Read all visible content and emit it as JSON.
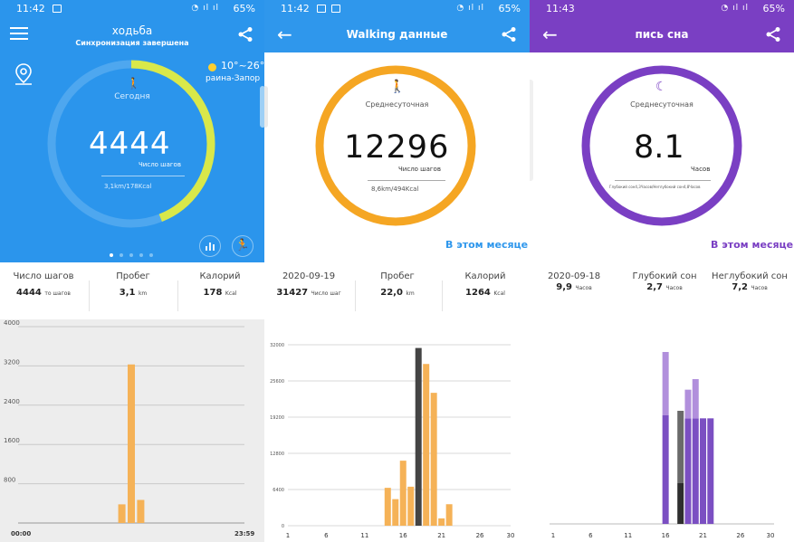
{
  "status_bar": [
    {
      "time": "11:42",
      "battery": "65%"
    },
    {
      "time": "11:42",
      "battery": "65%"
    },
    {
      "time": "11:43",
      "battery": "65%"
    }
  ],
  "panel1": {
    "title": "ходьба",
    "subtitle": "Синхронизация завершена",
    "today_label": "Сегодня",
    "steps": "4444",
    "steps_label": "Число шагов",
    "distance_kcal": "3,1km/178Kcal",
    "weather": "10°~26°",
    "location": "раина-Запор",
    "colors": {
      "header": "#2b95ec",
      "ring_track": "#4ea7ef",
      "ring_progress": "#d9e84a"
    },
    "progress_fraction": 0.44,
    "stats": [
      {
        "label": "Число шагов",
        "value": "4444",
        "unit": "то шагов"
      },
      {
        "label": "Пробег",
        "value": "3,1",
        "unit": "km"
      },
      {
        "label": "Калорий",
        "value": "178",
        "unit": "Kcal"
      }
    ]
  },
  "panel2": {
    "title": "Walking данные",
    "ring_label": "Среднесуточная",
    "value": "12296",
    "value_label": "Число шагов",
    "distance_kcal": "8,6km/494Kcal",
    "month_link": "В этом месяце",
    "colors": {
      "ring": "#f5a623",
      "accent": "#2f97ec"
    },
    "stats": [
      {
        "label": "2020-09-19",
        "value": "31427",
        "unit": "Число шаг"
      },
      {
        "label": "Пробег",
        "value": "22,0",
        "unit": "km"
      },
      {
        "label": "Калорий",
        "value": "1264",
        "unit": "Kcal"
      }
    ]
  },
  "panel3": {
    "title": "пись сна",
    "ring_label": "Среднесуточная",
    "value": "8.1",
    "value_label": "Часов",
    "sub_text": "Глубокий сон4,3Часов/Неглубокий сон4,8Часов",
    "month_link": "В этом месяце",
    "colors": {
      "ring": "#7a3fc3",
      "deep": "#7b4fc2",
      "light": "#b18fdc",
      "selected": "#444444"
    },
    "stats": [
      {
        "label": "2020-09-18",
        "value": "9,9",
        "unit": "Часов"
      },
      {
        "label": "Глубокий сон",
        "value": "2,7",
        "unit": "Часов"
      },
      {
        "label": "Неглубокий сон",
        "value": "7,2",
        "unit": "Часов"
      }
    ]
  },
  "chart_data": [
    {
      "type": "bar",
      "x": [
        11,
        12,
        13
      ],
      "x_tick_labels": [
        "00:00",
        "23:59"
      ],
      "values": [
        380,
        3230,
        470
      ],
      "ylim": [
        0,
        4000
      ],
      "y_ticks": [
        800,
        1600,
        2400,
        3200,
        4000
      ],
      "grid": true,
      "color": "#f5b257"
    },
    {
      "type": "bar",
      "x": [
        14,
        15,
        16,
        17,
        18,
        19,
        20,
        21,
        22,
        23
      ],
      "values": [
        6700,
        4700,
        11500,
        6900,
        31427,
        28600,
        23500,
        1300,
        3800,
        0
      ],
      "highlight_index": 4,
      "ylim": [
        0,
        32000
      ],
      "y_ticks": [
        0,
        6400,
        12800,
        19200,
        25600,
        32000
      ],
      "x_tick_labels": [
        "1",
        "6",
        "11",
        "16",
        "21",
        "26",
        "30"
      ],
      "grid": true,
      "colors": {
        "bar": "#f5b257",
        "highlight": "#444444"
      }
    },
    {
      "type": "bar",
      "x": [
        16,
        18,
        19,
        20,
        21,
        22
      ],
      "series": [
        {
          "name": "Глубокий сон",
          "values": [
            7.2,
            2.7,
            7.0,
            7.0,
            7.0,
            7.0
          ]
        },
        {
          "name": "Неглубокий сон",
          "values": [
            4.2,
            4.8,
            1.9,
            2.6,
            0,
            0
          ]
        }
      ],
      "highlight_index": 1,
      "x_tick_labels": [
        "1",
        "6",
        "11",
        "16",
        "21",
        "26",
        "30"
      ],
      "grid": false
    }
  ]
}
